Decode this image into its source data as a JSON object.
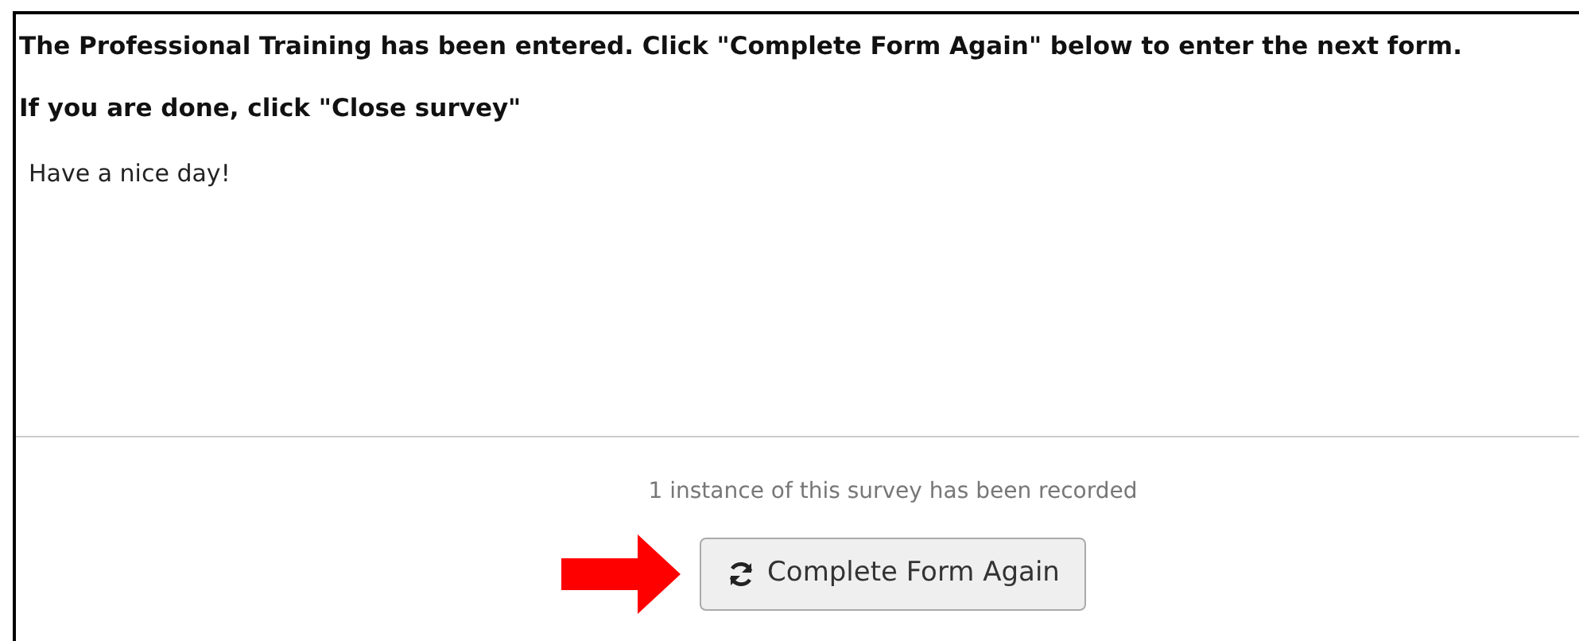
{
  "messages": [
    {
      "text": "The Professional Training has been entered. Click \"Complete Form Again\" below to enter the next form."
    },
    {
      "text": "If you are done, click \"Close survey\""
    }
  ],
  "closing_text": "Have a nice day!",
  "footer": {
    "record_note": "1 instance of this survey has been recorded",
    "button": {
      "label": "Complete Form Again"
    }
  }
}
